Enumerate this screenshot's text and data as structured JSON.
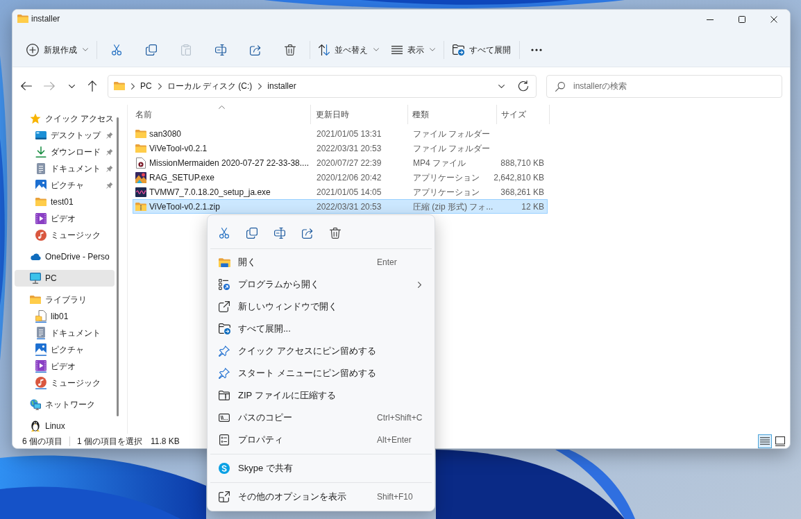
{
  "window": {
    "title": "installer"
  },
  "toolbar": [
    {
      "items": [
        {
          "kind": "new",
          "label": "新規作成",
          "dropdown": true,
          "disabled": false
        }
      ]
    },
    {
      "items": [
        {
          "kind": "cut",
          "dropdown": false,
          "disabled": false
        },
        {
          "kind": "copy",
          "dropdown": false,
          "disabled": false
        },
        {
          "kind": "paste",
          "dropdown": false,
          "disabled": true
        },
        {
          "kind": "rename",
          "dropdown": false,
          "disabled": false
        },
        {
          "kind": "share",
          "dropdown": false,
          "disabled": false
        },
        {
          "kind": "delete",
          "dropdown": false,
          "disabled": false
        }
      ]
    },
    {
      "items": [
        {
          "kind": "sort",
          "label": "並べ替え",
          "dropdown": true,
          "disabled": false
        },
        {
          "kind": "view",
          "label": "表示",
          "dropdown": true,
          "disabled": false
        }
      ]
    },
    {
      "items": [
        {
          "kind": "extract",
          "label": "すべて展開",
          "dropdown": false,
          "disabled": false
        }
      ]
    },
    {
      "items": [
        {
          "kind": "more",
          "dropdown": false,
          "disabled": false
        }
      ]
    }
  ],
  "navigation": [
    {
      "kind": "back",
      "disabled": false
    },
    {
      "kind": "forward",
      "disabled": true
    },
    {
      "kind": "recent",
      "disabled": false
    },
    {
      "kind": "up",
      "disabled": false
    }
  ],
  "address_bar": {
    "path": [
      "PC",
      "ローカル ディスク (C:)",
      "installer"
    ]
  },
  "search": {
    "placeholder": "installerの検索"
  },
  "sidebar": {
    "items": [
      {
        "kind": "star",
        "label": "クイック アクセス",
        "selected": false,
        "children": [
          {
            "kind": "desktop",
            "label": "デスクトップ",
            "pinned": true,
            "selected": false
          },
          {
            "kind": "download",
            "label": "ダウンロード",
            "pinned": true,
            "selected": false
          },
          {
            "kind": "document",
            "label": "ドキュメント",
            "pinned": true,
            "selected": false
          },
          {
            "kind": "picture",
            "label": "ピクチャ",
            "pinned": true,
            "selected": false
          },
          {
            "kind": "folder",
            "label": "test01",
            "pinned": false,
            "selected": false
          },
          {
            "kind": "video",
            "label": "ビデオ",
            "pinned": false,
            "selected": false
          },
          {
            "kind": "music",
            "label": "ミュージック",
            "pinned": false,
            "selected": false
          }
        ]
      },
      {
        "kind": "cloud",
        "label": "OneDrive - Perso",
        "selected": false
      },
      {
        "kind": "computer",
        "label": "PC",
        "selected": true
      },
      {
        "kind": "library",
        "label": "ライブラリ",
        "selected": false,
        "children": [
          {
            "kind": "file",
            "label": "lib01",
            "selected": false
          },
          {
            "kind": "document",
            "label": "ドキュメント",
            "selected": false
          },
          {
            "kind": "picture",
            "label": "ピクチャ",
            "selected": false
          },
          {
            "kind": "video",
            "label": "ビデオ",
            "selected": false
          },
          {
            "kind": "music",
            "label": "ミュージック",
            "selected": false
          }
        ]
      },
      {
        "kind": "network",
        "label": "ネットワーク",
        "selected": false
      },
      {
        "kind": "linux",
        "label": "Linux",
        "selected": false
      }
    ]
  },
  "file_list": {
    "columns": [
      {
        "label": "名前",
        "sorted": true
      },
      {
        "label": "更新日時",
        "sorted": false
      },
      {
        "label": "種類",
        "sorted": false
      },
      {
        "label": "サイズ",
        "sorted": false
      }
    ],
    "rows": [
      {
        "kind": "folder",
        "name": "san3080",
        "modified": "2021/01/05 13:31",
        "type": "ファイル フォルダー",
        "selected": false
      },
      {
        "kind": "folder",
        "name": "ViVeTool-v0.2.1",
        "modified": "2022/03/31 20:53",
        "type": "ファイル フォルダー",
        "selected": false
      },
      {
        "kind": "video",
        "name": "MissionMermaiden 2020-07-27 22-33-38....",
        "modified": "2020/07/27 22:39",
        "type": "MP4 ファイル",
        "size": "888,710 KB",
        "selected": false
      },
      {
        "kind": "artapp",
        "name": "RAG_SETUP.exe",
        "modified": "2020/12/06 20:42",
        "type": "アプリケーション",
        "size": "2,642,810 KB",
        "selected": false
      },
      {
        "kind": "waveapp",
        "name": "TVMW7_7.0.18.20_setup_ja.exe",
        "modified": "2021/01/05 14:05",
        "type": "アプリケーション",
        "size": "368,261 KB",
        "selected": false
      },
      {
        "kind": "zip",
        "name": "ViVeTool-v0.2.1.zip",
        "modified": "2022/03/31 20:53",
        "type": "圧縮 (zip 形式) フォ...",
        "size": "12 KB",
        "selected": true
      }
    ]
  },
  "status_bar": {
    "item_count": "6 個の項目",
    "selection": "1 個の項目を選択",
    "selection_size": "11.8 KB",
    "views": [
      {
        "kind": "details",
        "selected": true
      },
      {
        "kind": "tiles",
        "selected": false
      }
    ]
  },
  "context_menu": {
    "quick_actions": [
      {
        "kind": "cut"
      },
      {
        "kind": "copy"
      },
      {
        "kind": "rename"
      },
      {
        "kind": "share"
      },
      {
        "kind": "delete"
      }
    ],
    "sections": [
      {
        "items": [
          {
            "kind": "open",
            "label": "開く",
            "shortcut": "Enter",
            "submenu": false
          },
          {
            "kind": "openwith",
            "label": "プログラムから開く",
            "submenu": true
          },
          {
            "kind": "newwindow",
            "label": "新しいウィンドウで開く",
            "submenu": false
          },
          {
            "kind": "extract",
            "label": "すべて展開...",
            "submenu": false
          },
          {
            "kind": "pin",
            "label": "クイック アクセスにピン留めする",
            "submenu": false
          },
          {
            "kind": "pin",
            "label": "スタート メニューにピン留めする",
            "submenu": false
          },
          {
            "kind": "compress",
            "label": "ZIP ファイルに圧縮する",
            "submenu": false
          },
          {
            "kind": "copypath",
            "label": "パスのコピー",
            "shortcut": "Ctrl+Shift+C",
            "submenu": false
          },
          {
            "kind": "properties",
            "label": "プロパティ",
            "shortcut": "Alt+Enter",
            "submenu": false
          }
        ]
      },
      {
        "items": [
          {
            "kind": "skype",
            "label": "Skype で共有",
            "submenu": false
          }
        ]
      },
      {
        "items": [
          {
            "kind": "moreoptions",
            "label": "その他のオプションを表示",
            "shortcut": "Shift+F10",
            "submenu": false
          }
        ]
      }
    ]
  }
}
